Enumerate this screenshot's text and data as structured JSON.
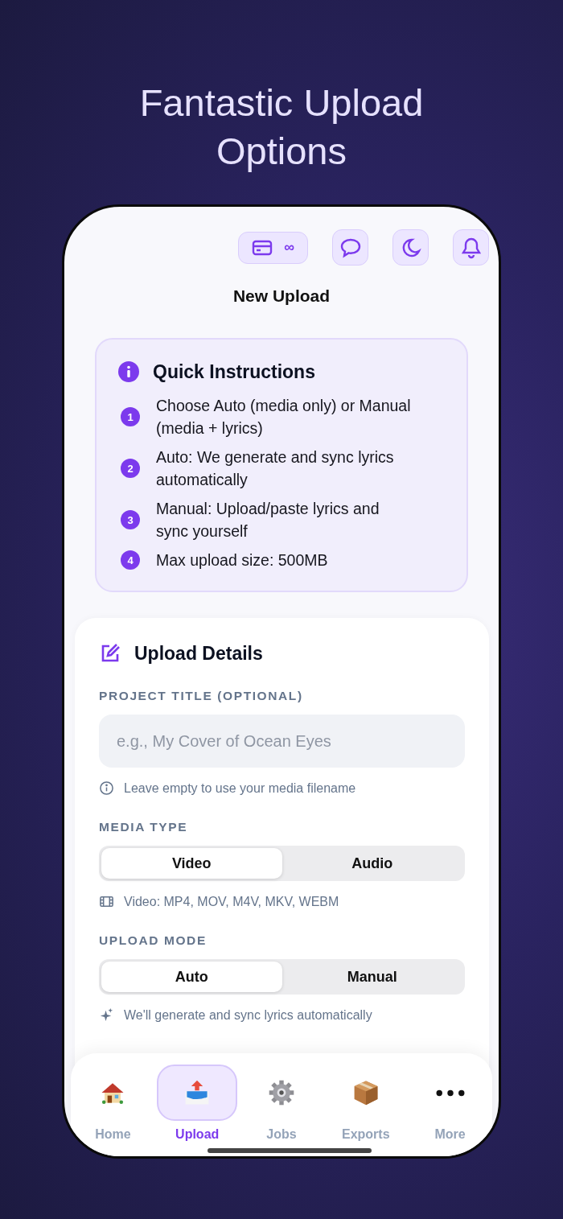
{
  "headline": "Fantastic Upload Options",
  "top_bar": {
    "credits": "∞"
  },
  "screen_title": "New Upload",
  "instructions": {
    "title": "Quick Instructions",
    "steps": [
      {
        "number": "1",
        "text": "Choose Auto (media only) or Manual (media + lyrics)"
      },
      {
        "number": "2",
        "text": "Auto: We generate and sync lyrics automatically"
      },
      {
        "number": "3",
        "text": "Manual: Upload/paste lyrics and sync yourself"
      },
      {
        "number": "4",
        "text": "Max upload size: 500MB"
      }
    ]
  },
  "details": {
    "title": "Upload Details",
    "project_title": {
      "label": "PROJECT TITLE (OPTIONAL)",
      "placeholder": "e.g., My Cover of Ocean Eyes",
      "hint": "Leave empty to use your media filename"
    },
    "sections": [
      {
        "kind": "media",
        "label": "MEDIA TYPE",
        "options": [
          {
            "label": "Video",
            "selected": true
          },
          {
            "label": "Audio",
            "selected": false
          }
        ],
        "hint": "Video: MP4, MOV, M4V, MKV, WEBM"
      },
      {
        "kind": "mode",
        "label": "UPLOAD MODE",
        "options": [
          {
            "label": "Auto",
            "selected": true
          },
          {
            "label": "Manual",
            "selected": false
          }
        ],
        "hint": "We'll generate and sync lyrics automatically"
      }
    ]
  },
  "tab_bar": [
    {
      "kind": "home",
      "label": "Home",
      "selected": false
    },
    {
      "kind": "upload",
      "label": "Upload",
      "selected": true
    },
    {
      "kind": "jobs",
      "label": "Jobs",
      "selected": false
    },
    {
      "kind": "exports",
      "label": "Exports",
      "selected": false
    },
    {
      "kind": "more",
      "label": "More",
      "selected": false
    }
  ]
}
